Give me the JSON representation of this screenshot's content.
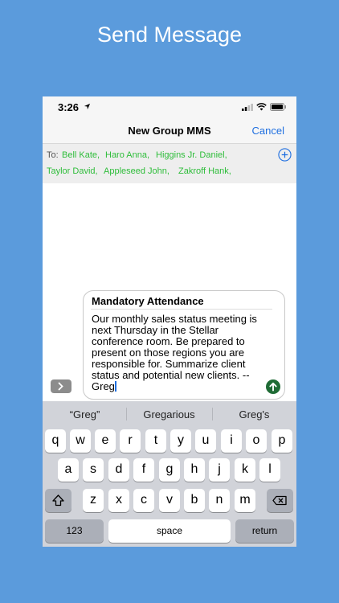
{
  "headline": "Send Message",
  "status": {
    "time": "3:26"
  },
  "nav": {
    "title": "New Group MMS",
    "cancel": "Cancel"
  },
  "recipients": {
    "to_label": "To:",
    "names": [
      "Bell Kate,",
      "Haro Anna,",
      "Higgins Jr. Daniel,",
      "Taylor David,",
      "Appleseed John,",
      "Zakroff Hank,"
    ]
  },
  "message": {
    "subject": "Mandatory Attendance",
    "lines": [
      "Our monthly sales status meeting is",
      "next Thursday in the Stellar",
      "conference room. Be prepared to",
      "present on those regions you are",
      "responsible for. Summarize client",
      "status and potential new clients. --",
      "Greg"
    ]
  },
  "suggestions": [
    "“Greg”",
    "Gregarious",
    "Greg's"
  ],
  "keyboard": {
    "row1": [
      "q",
      "w",
      "e",
      "r",
      "t",
      "y",
      "u",
      "i",
      "o",
      "p"
    ],
    "row2": [
      "a",
      "s",
      "d",
      "f",
      "g",
      "h",
      "j",
      "k",
      "l"
    ],
    "row3": [
      "z",
      "x",
      "c",
      "v",
      "b",
      "n",
      "m"
    ],
    "numbers": "123",
    "space": "space",
    "return": "return"
  },
  "icons": {
    "location": "location-arrow-icon",
    "signal": "cell-signal-icon",
    "wifi": "wifi-icon",
    "battery": "battery-icon",
    "add": "add-recipient-icon",
    "send": "send-arrow-icon",
    "expand": "chevron-right-icon",
    "shift": "shift-icon",
    "delete": "backspace-icon"
  },
  "colors": {
    "background": "#5b9bdc",
    "link": "#1f6fe0",
    "recipient": "#2ebd3a",
    "send": "#1f6b35"
  }
}
